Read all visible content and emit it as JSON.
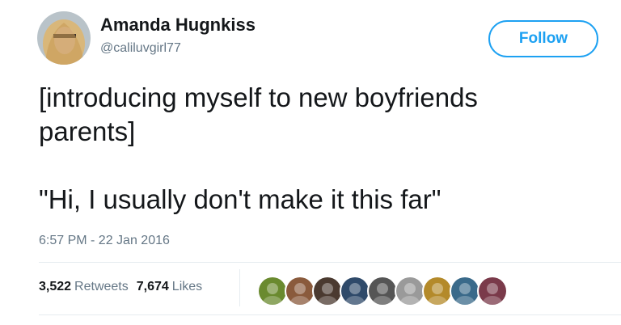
{
  "tweet": {
    "author": {
      "display_name": "Amanda Hugnkiss",
      "handle": "@caliluvgirl77"
    },
    "follow_label": "Follow",
    "text": "[introducing myself to new boyfriends\nparents]\n\n\"Hi, I usually don't make it this far\"",
    "timestamp": "6:57 PM - 22 Jan 2016",
    "stats": {
      "retweets_count": "3,522",
      "retweets_label": "Retweets",
      "likes_count": "7,674",
      "likes_label": "Likes"
    }
  },
  "colors": {
    "accent": "#1da1f2",
    "secondary_text": "#657786",
    "primary_text": "#14171a",
    "divider": "#e6ecf0"
  },
  "liker_avatars": [
    {
      "icon": "avatar-photo-green",
      "color": "#6a8a2f"
    },
    {
      "icon": "avatar-photo-man",
      "color": "#8a5a3c"
    },
    {
      "icon": "avatar-photo-dark",
      "color": "#4b3a30"
    },
    {
      "icon": "avatar-photo-blue",
      "color": "#2f4a6a"
    },
    {
      "icon": "avatar-photo-pet",
      "color": "#555555"
    },
    {
      "icon": "avatar-photo-light",
      "color": "#9a9a9a"
    },
    {
      "icon": "avatar-photo-gold",
      "color": "#b48a2a"
    },
    {
      "icon": "avatar-photo-teal",
      "color": "#3a6a8a"
    },
    {
      "icon": "avatar-photo-rose",
      "color": "#7a3a4a"
    }
  ]
}
